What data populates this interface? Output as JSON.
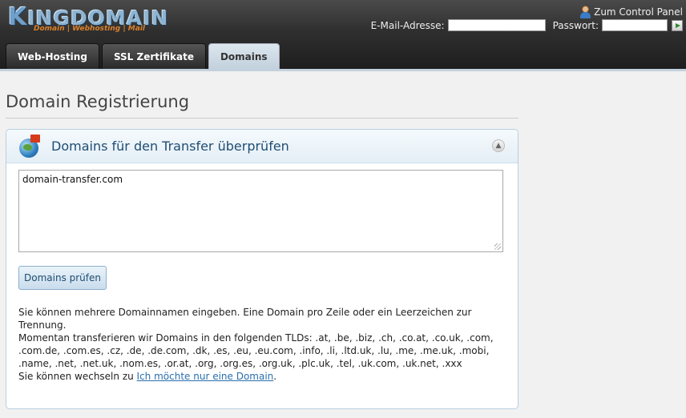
{
  "brand": {
    "logo_initial": "K",
    "logo_rest": "INGDOMAIN",
    "tagline": "Domain | Webhosting | Mail"
  },
  "header": {
    "control_panel_link": "Zum Control Panel",
    "email_label": "E-Mail-Adresse:",
    "password_label": "Passwort:"
  },
  "tabs": [
    {
      "label": "Web-Hosting",
      "active": false
    },
    {
      "label": "SSL Zertifikate",
      "active": false
    },
    {
      "label": "Domains",
      "active": true
    }
  ],
  "page": {
    "title": "Domain Registrierung"
  },
  "panel": {
    "title": "Domains für den Transfer überprüfen",
    "textarea_value": "domain-transfer.com",
    "check_button": "Domains prüfen",
    "info_line1": "Sie können mehrere Domainnamen eingeben. Eine Domain pro Zeile oder ein Leerzeichen zur Trennung.",
    "info_line2": "Momentan transferieren wir Domains in den folgenden TLDs: .at, .be, .biz, .ch, .co.at, .co.uk, .com, .com.de, .com.es, .cz, .de, .de.com, .dk, .es, .eu, .eu.com, .info, .li, .ltd.uk, .lu, .me, .me.uk, .mobi, .name, .net, .net.uk, .nom.es, .or.at, .org, .org.es, .org.uk, .plc.uk, .tel, .uk.com, .uk.net, .xxx",
    "info_line3_prefix": "Sie können wechseln zu",
    "single_domain_link": "Ich möchte nur eine Domain",
    "info_line3_suffix": "."
  },
  "colors": {
    "accent": "#1f4d73",
    "link": "#2a6fae",
    "header_bg": "#2f2f2f",
    "active_tab": "#c2d1dd"
  }
}
